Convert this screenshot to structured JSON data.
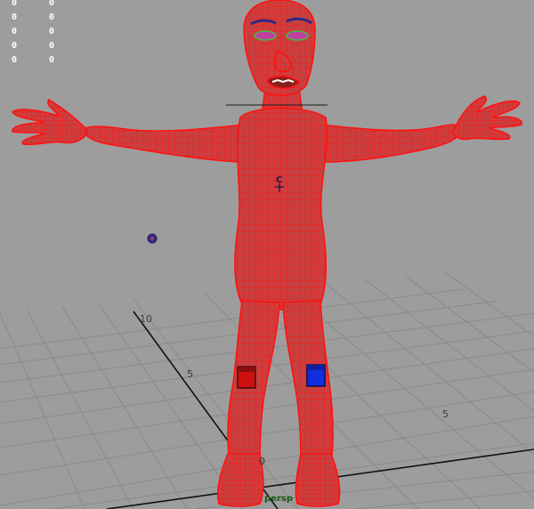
{
  "viewport": {
    "camera_label": "persp",
    "hud_left": [
      "0",
      "0",
      "0",
      "0",
      "0"
    ],
    "hud_right": [
      "0",
      "0",
      "0",
      "0",
      "0"
    ],
    "grid_labels": {
      "ten": "10",
      "five_left": "5",
      "five_right": "5",
      "zero": "0"
    },
    "pivot_label": "C"
  },
  "colors": {
    "background": "#9d9d9d",
    "grid": "#8a8a8a",
    "axis": "#111111",
    "wireframe": "#ff1010",
    "body_fill": "#c94545",
    "left_knee_control": "#d01010",
    "right_knee_control": "#1030e0",
    "eyebrow": "#2a2a8a",
    "eyelid": "#40c040",
    "locator": "#3a2a8a"
  },
  "icons": {
    "locator": "sphere-locator-icon",
    "pivot": "pivot-manipulator-icon"
  }
}
